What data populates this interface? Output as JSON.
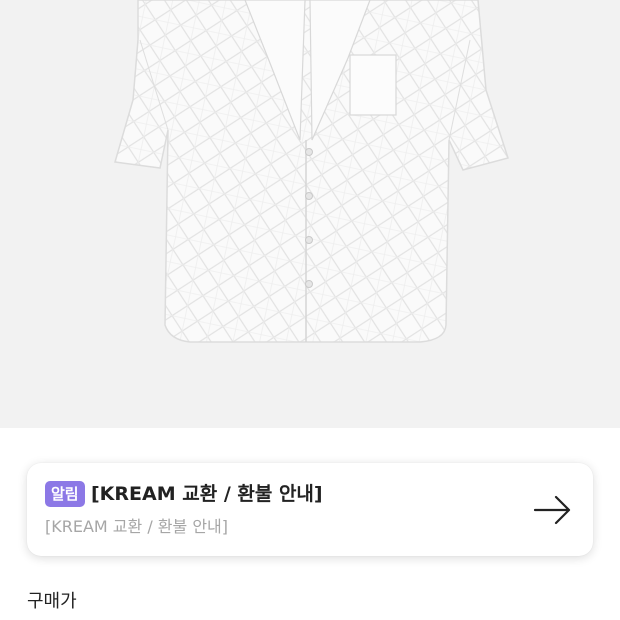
{
  "product": {
    "image_icon": "white-short-sleeve-shirt"
  },
  "notice": {
    "badge": "알림",
    "title": "[KREAM 교환 / 환불 안내]",
    "subtitle": "[KREAM 교환 / 환불 안내]",
    "arrow_icon": "arrow-right-icon",
    "badge_color": "#8c78e6"
  },
  "price": {
    "label": "구매가"
  }
}
